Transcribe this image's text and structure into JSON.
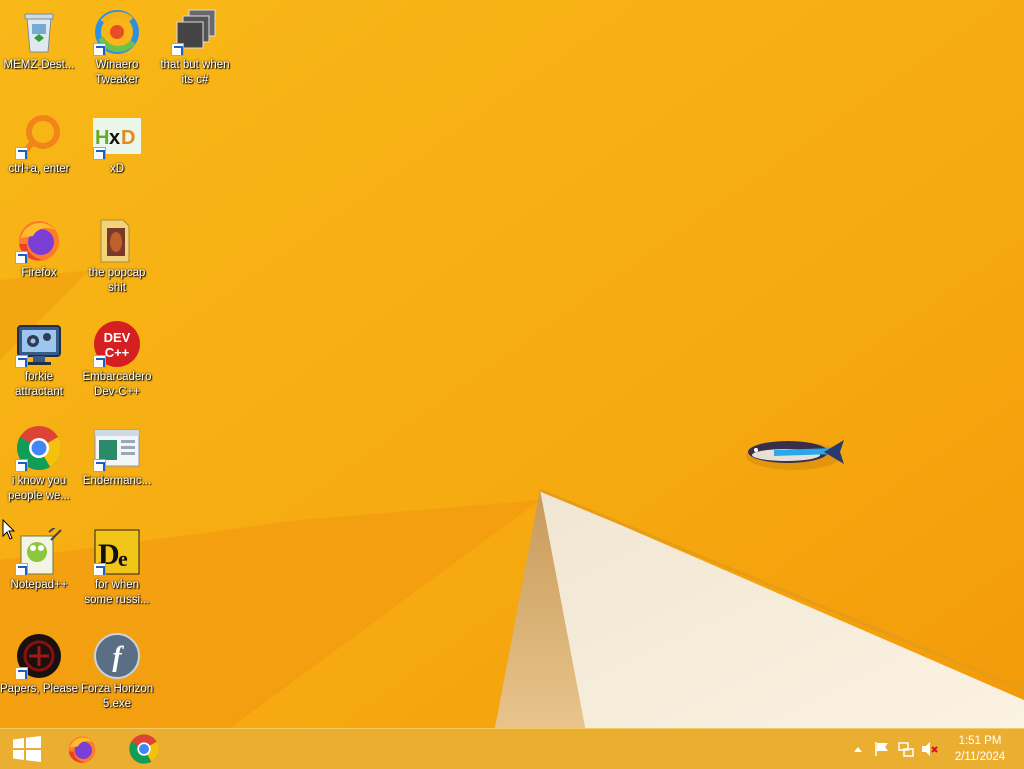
{
  "desktop": {
    "icons": [
      {
        "label": "MEMZ-Dest...",
        "icon": "recycle-bin-icon"
      },
      {
        "label": "Winaero\nTweaker",
        "icon": "winaero-icon"
      },
      {
        "label": "that but when\nits c#",
        "icon": "stacked-windows-icon"
      },
      {
        "label": "ctrl+a, enter",
        "icon": "magnifier-ring-icon"
      },
      {
        "label": "xD",
        "icon": "hxd-icon"
      },
      {
        "label": "Firefox",
        "icon": "firefox-icon"
      },
      {
        "label": "the popcap\nshit",
        "icon": "folder-icon"
      },
      {
        "label": "forkie\nattractant",
        "icon": "monitor-gears-icon"
      },
      {
        "label": "Embarcadero\nDev-C++",
        "icon": "devcpp-icon"
      },
      {
        "label": "i know you\npeople we...",
        "icon": "chrome-icon"
      },
      {
        "label": "Endermanc...",
        "icon": "window-icon"
      },
      {
        "label": "Notepad++",
        "icon": "notepadpp-icon"
      },
      {
        "label": "for when\nsome russi...",
        "icon": "de-icon"
      },
      {
        "label": "Papers, Please",
        "icon": "papers-please-icon"
      },
      {
        "label": "Forza Horizon\n5.exe",
        "icon": "flash-icon"
      }
    ],
    "devcpp_badge": "DEV\nC++",
    "hxd_badge": "HxD",
    "de_badge": "De"
  },
  "taskbar": {
    "pinned": [
      "start-button",
      "firefox",
      "chrome"
    ],
    "clock_time": "1:51 PM",
    "clock_date": "2/11/2024"
  },
  "colors": {
    "wallpaper": "#f6a912",
    "taskbar": "#e8b034"
  }
}
